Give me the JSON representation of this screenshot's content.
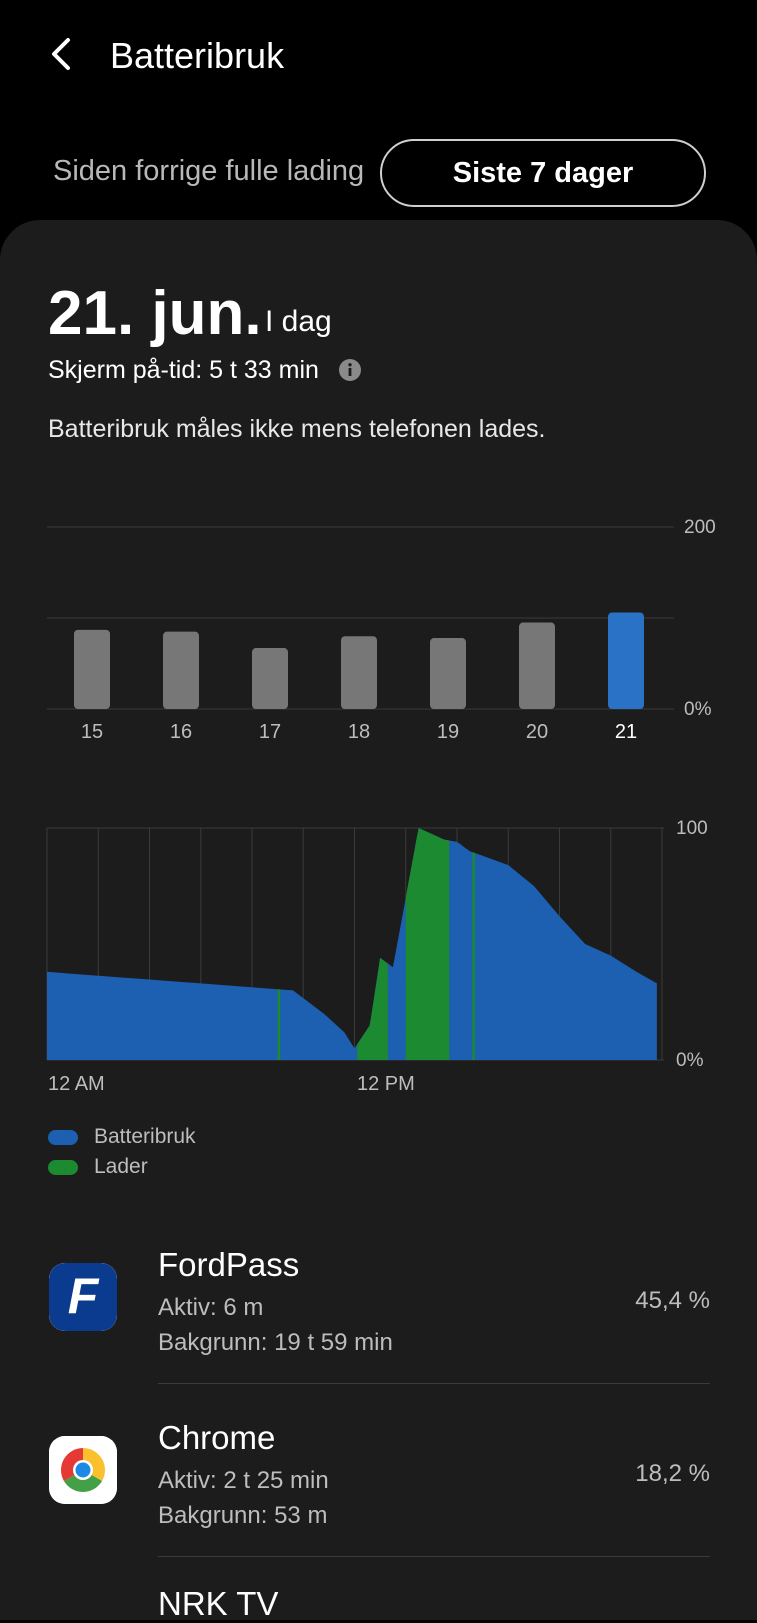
{
  "header": {
    "title": "Batteribruk"
  },
  "tabs": {
    "since_full_charge": "Siden forrige fulle lading",
    "last_7_days": "Siste 7 dager"
  },
  "summary": {
    "date": "21. jun.",
    "day_label": "I dag",
    "screen_on_time": "Skjerm på-tid: 5 t 33 min",
    "charging_note": "Batteribruk måles ikke mens telefonen lades."
  },
  "colors": {
    "usage": "#1d5fb0",
    "charging": "#1b8a30",
    "selected_bar": "#2a72c6",
    "bar": "#777777"
  },
  "chart_data": [
    {
      "type": "bar",
      "categories": [
        "15",
        "16",
        "17",
        "18",
        "19",
        "20",
        "21"
      ],
      "values": [
        87,
        85,
        67,
        80,
        78,
        95,
        106
      ],
      "selected": "21",
      "ytick_labels": [
        "0%",
        "200"
      ],
      "ylim": [
        0,
        200
      ],
      "grid": true
    },
    {
      "type": "area",
      "x": [
        0,
        1.2,
        2.4,
        3.6,
        4.8,
        6.0,
        7.2,
        8.4,
        9.6,
        10.8,
        11.6,
        12.0,
        12.6,
        13.0,
        13.5,
        14.0,
        14.5,
        15.5,
        16.0,
        16.5,
        17.0,
        18.0,
        19.0,
        20.0,
        21.0,
        22.0,
        23.0,
        23.8
      ],
      "series": [
        {
          "name": "Batteribruk",
          "values": [
            38,
            37,
            36,
            35,
            34,
            33,
            32,
            31,
            30,
            20,
            12,
            5,
            15,
            44,
            40,
            70,
            100,
            95,
            94,
            90,
            88,
            84,
            75,
            62,
            50,
            45,
            38,
            33
          ]
        },
        {
          "name": "Lader",
          "segments": [
            [
              12.1,
              13.3
            ],
            [
              14.0,
              15.7
            ],
            [
              9.0,
              9.1
            ],
            [
              16.6,
              16.7
            ]
          ]
        }
      ],
      "xtick_labels": [
        "12 AM",
        "12 PM"
      ],
      "ytick_labels": [
        "0%",
        "100"
      ],
      "ylim": [
        0,
        100
      ],
      "grid": true
    }
  ],
  "legend": [
    {
      "label": "Batteribruk",
      "color": "#1d5fb0"
    },
    {
      "label": "Lader",
      "color": "#1b8a30"
    }
  ],
  "apps": [
    {
      "name": "FordPass",
      "active": "Aktiv: 6 m",
      "background": "Bakgrunn: 19 t 59 min",
      "percent": "45,4 %",
      "icon": "fordpass-logo-icon"
    },
    {
      "name": "Chrome",
      "active": "Aktiv: 2 t 25 min",
      "background": "Bakgrunn: 53 m",
      "percent": "18,2 %",
      "icon": "chrome-logo-icon"
    },
    {
      "name": "NRK TV",
      "icon": "nrk-tv-icon"
    }
  ]
}
